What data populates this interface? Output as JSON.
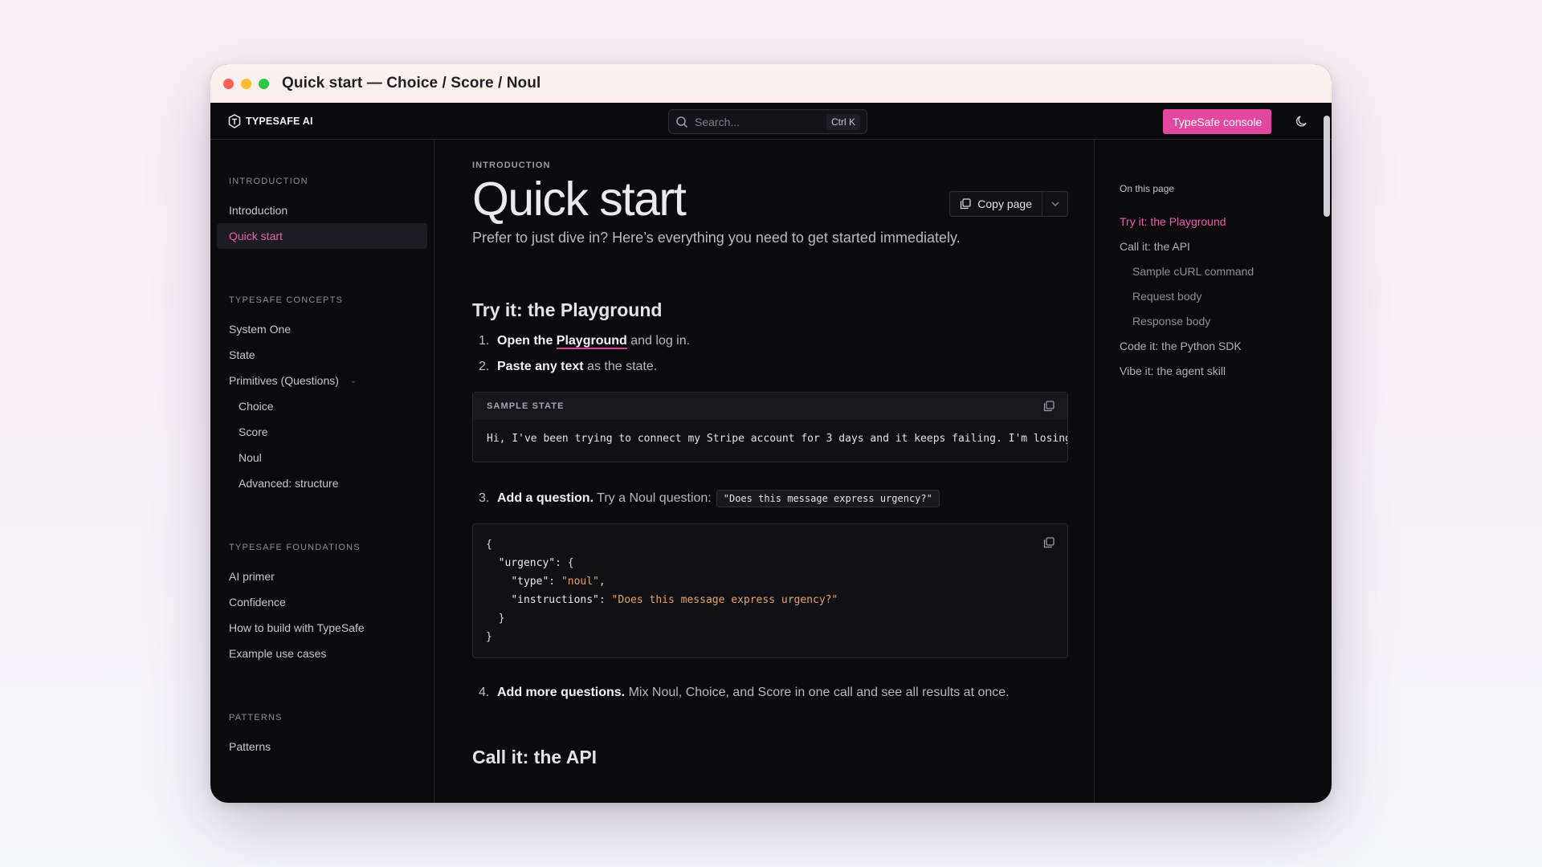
{
  "window": {
    "title": "Quick start — Choice / Score / Noul"
  },
  "nav": {
    "logo_text": "TYPESAFE AI",
    "search_placeholder": "Search...",
    "search_shortcut": "Ctrl K",
    "console_button": "TypeSafe console"
  },
  "sidebar": {
    "sections": [
      {
        "title": "INTRODUCTION",
        "items": [
          "Introduction",
          "Quick start"
        ]
      },
      {
        "title": "TYPESAFE CONCEPTS",
        "items": [
          "System One",
          "State",
          "Primitives (Questions)",
          "Choice",
          "Score",
          "Noul",
          "Advanced: structure"
        ]
      },
      {
        "title": "TYPESAFE FOUNDATIONS",
        "items": [
          "AI primer",
          "Confidence",
          "How to build with TypeSafe",
          "Example use cases"
        ]
      },
      {
        "title": "PATTERNS",
        "items": [
          "Patterns"
        ]
      }
    ],
    "active": "Quick start"
  },
  "main": {
    "eyebrow": "INTRODUCTION",
    "title": "Quick start",
    "copy_page": "Copy page",
    "lead": "Prefer to just dive in? Here’s everything you need to get started immediately.",
    "section1_title": "Try it: the Playground",
    "steps": [
      {
        "num": "1.",
        "bold": "Open the ",
        "link": "Playground",
        "rest": " and log in."
      },
      {
        "num": "2.",
        "bold": "Paste any text",
        "rest": " as the state."
      },
      {
        "num": "3.",
        "bold": "Add a question.",
        "rest": " Try a Noul question:",
        "code": "\"Does this message express urgency?\""
      },
      {
        "num": "4.",
        "bold": "Add more questions.",
        "rest": " Mix Noul, Choice, and Score in one call and see all results at once."
      }
    ],
    "sample_state_label": "SAMPLE STATE",
    "sample_state_text": "Hi, I've been trying to connect my Stripe account for 3 days and it keeps failing. I'm losing sales every hour this isn't fixed.",
    "code_lines": {
      "l1": "{",
      "l2_key": "\"urgency\"",
      "l2_rest": ": {",
      "l3_key": "\"type\"",
      "l3_sep": ": ",
      "l3_val": "\"noul\"",
      "l3_end": ",",
      "l4_key": "\"instructions\"",
      "l4_sep": ": ",
      "l4_val": "\"Does this message express urgency?\"",
      "l5": "}",
      "l6": "}"
    },
    "section2_title": "Call it: the API"
  },
  "toc": {
    "title": "On this page",
    "items": [
      {
        "label": "Try it: the Playground",
        "level": 0,
        "active": true
      },
      {
        "label": "Call it: the API",
        "level": 0
      },
      {
        "label": "Sample cURL command",
        "level": 1
      },
      {
        "label": "Request body",
        "level": 1
      },
      {
        "label": "Response body",
        "level": 1
      },
      {
        "label": "Code it: the Python SDK",
        "level": 0
      },
      {
        "label": "Vibe it: the agent skill",
        "level": 0
      }
    ]
  },
  "colors": {
    "accent": "#e3479f",
    "accent_text": "#ef5cb3",
    "background": "#0b0b0e"
  }
}
